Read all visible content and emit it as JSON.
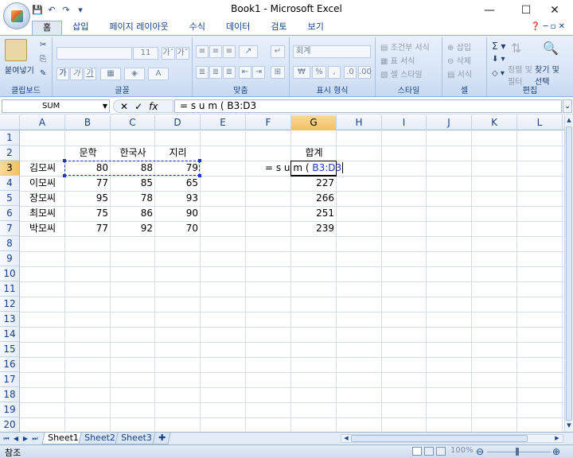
{
  "window": {
    "title": "Book1 - Microsoft Excel",
    "minimize": "—",
    "maximize": "☐",
    "close": "✕"
  },
  "qat": {
    "save": "💾",
    "undo": "↶",
    "redo": "↷",
    "more": "▾"
  },
  "tabs": [
    "홈",
    "삽입",
    "페이지 레이아웃",
    "수식",
    "데이터",
    "검토",
    "보기"
  ],
  "active_tab": "홈",
  "ribbon": {
    "clipboard": {
      "label": "클립보드",
      "paste": "붙여넣기"
    },
    "font": {
      "label": "글꼴",
      "size": "11",
      "grow": "가ˆ",
      "shrink": "가ˇ",
      "bold": "가",
      "italic": "가",
      "underline": "가"
    },
    "alignment": {
      "label": "맞춤"
    },
    "number": {
      "label": "표시 형식",
      "format": "회계",
      "percent": "%",
      "comma": ","
    },
    "styles": {
      "label": "스타일",
      "cond": "조건부 서식",
      "table": "표 서식",
      "cell": "셀 스타일"
    },
    "cells": {
      "label": "셀",
      "insert": "삽입",
      "delete": "삭제",
      "format": "서식"
    },
    "editing": {
      "label": "편집",
      "sort": "정렬 및",
      "filter": "필터",
      "find": "찾기 및",
      "select": "선택"
    }
  },
  "formula_bar": {
    "name_box": "SUM",
    "cancel": "✕",
    "enter": "✓",
    "fx": "fx",
    "formula": "= s u m ( B3:D3"
  },
  "columns": [
    "A",
    "B",
    "C",
    "D",
    "E",
    "F",
    "G",
    "H",
    "I",
    "J",
    "K",
    "L"
  ],
  "selected_column": "G",
  "rows": [
    "1",
    "2",
    "3",
    "4",
    "5",
    "6",
    "7",
    "8",
    "9",
    "10",
    "11",
    "12",
    "13",
    "14",
    "15",
    "16",
    "17",
    "18",
    "19",
    "20"
  ],
  "selected_row": "3",
  "sheet": {
    "headers": {
      "b": "문학",
      "c": "한국사",
      "d": "지리",
      "g": "합계"
    },
    "data": [
      {
        "name": "김모씨",
        "b": "80",
        "c": "88",
        "d": "79",
        "g": ""
      },
      {
        "name": "이모씨",
        "b": "77",
        "c": "85",
        "d": "65",
        "g": "227"
      },
      {
        "name": "장모씨",
        "b": "95",
        "c": "78",
        "d": "93",
        "g": "266"
      },
      {
        "name": "최모씨",
        "b": "75",
        "c": "86",
        "d": "90",
        "g": "251"
      },
      {
        "name": "박모씨",
        "b": "77",
        "c": "92",
        "d": "70",
        "g": "239"
      }
    ],
    "editing_cell": {
      "prefix": "= s u m (",
      "ref": "B3:D3"
    }
  },
  "sheet_tabs": [
    "Sheet1",
    "Sheet2",
    "Sheet3"
  ],
  "status": {
    "mode": "참조",
    "zoom": "100%"
  },
  "colors": {
    "accent": "#15428b",
    "selection": "#f1c15f",
    "ref_blue": "#1a37c7"
  }
}
